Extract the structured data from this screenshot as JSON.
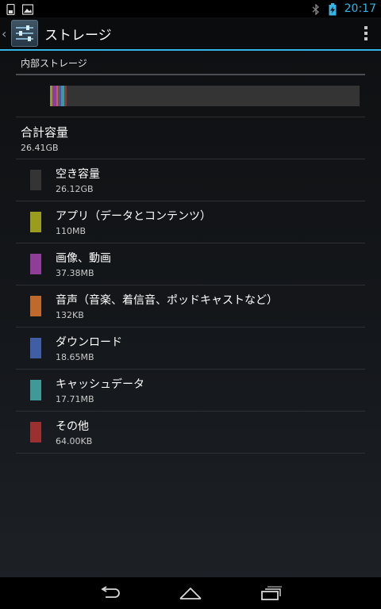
{
  "status_bar": {
    "time": "20:17",
    "icons": [
      "phone-storage-icon",
      "image-notification-icon",
      "bluetooth-icon",
      "battery-charging-icon"
    ]
  },
  "action_bar": {
    "title": "ストレージ",
    "app_icon": "settings-sliders-icon",
    "overflow_icon": "overflow-menu-icon"
  },
  "storage": {
    "section_header": "内部ストレージ",
    "total_label": "合計容量",
    "total_value": "26.41GB",
    "items": [
      {
        "label": "空き容量",
        "value": "26.12GB",
        "color": "#343434"
      },
      {
        "label": "アプリ（データとコンテンツ）",
        "value": "110MB",
        "color": "#9a9c1e"
      },
      {
        "label": "画像、動画",
        "value": "37.38MB",
        "color": "#8e3e97"
      },
      {
        "label": "音声（音楽、着信音、ポッドキャストなど）",
        "value": "132KB",
        "color": "#bd6a2c"
      },
      {
        "label": "ダウンロード",
        "value": "18.65MB",
        "color": "#3f5ea3"
      },
      {
        "label": "キャッシュデータ",
        "value": "17.71MB",
        "color": "#3f9a97"
      },
      {
        "label": "その他",
        "value": "64.00KB",
        "color": "#9a3030"
      }
    ],
    "usage_segments": [
      {
        "name": "apps",
        "color": "#9a9c1e",
        "fraction": 0.008
      },
      {
        "name": "media",
        "color": "#8e3e97",
        "fraction": 0.012
      },
      {
        "name": "audio",
        "color": "#bd6a2c",
        "fraction": 0.006
      },
      {
        "name": "downloads",
        "color": "#3f5ea3",
        "fraction": 0.01
      },
      {
        "name": "cache",
        "color": "#3f9a97",
        "fraction": 0.01
      },
      {
        "name": "misc",
        "color": "#9a3030",
        "fraction": 0.008
      },
      {
        "name": "free",
        "color": "#343434",
        "fraction": 0.946
      }
    ]
  },
  "nav_bar": {
    "back_icon": "back-icon",
    "home_icon": "home-icon",
    "recents_icon": "recent-apps-icon"
  }
}
